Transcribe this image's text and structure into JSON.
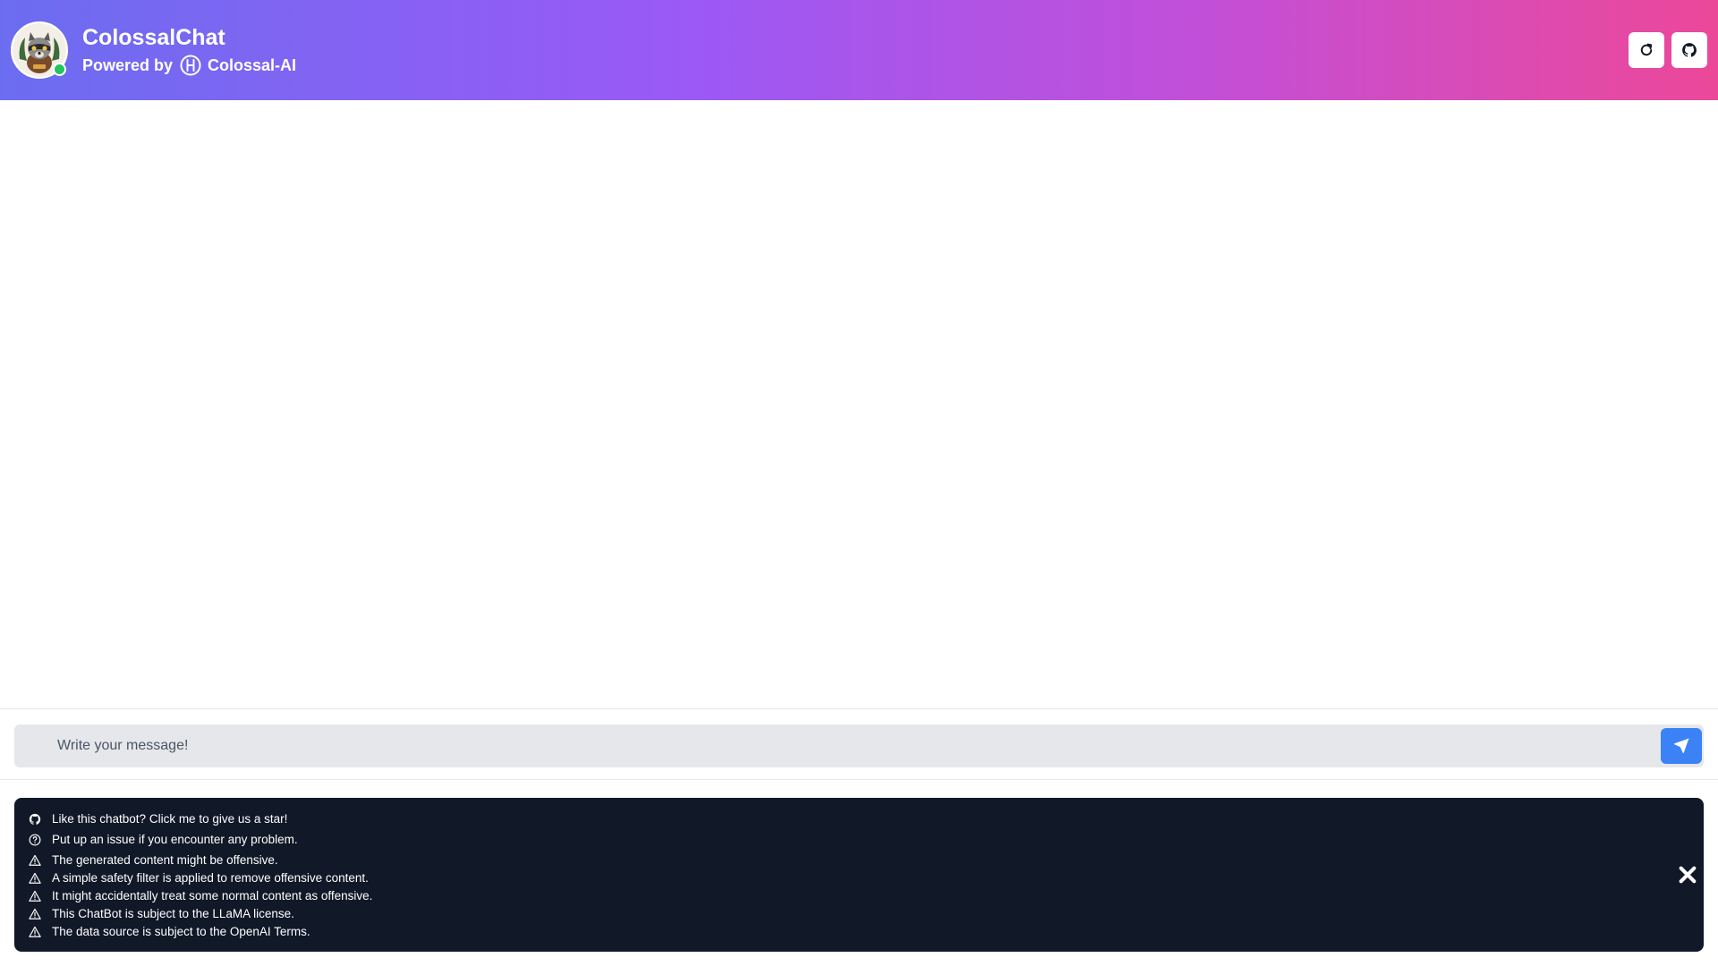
{
  "header": {
    "title": "ColossalChat",
    "powered_by": "Powered by",
    "org_name": "Colossal-AI",
    "refresh_icon": "refresh-icon",
    "github_icon": "github-icon"
  },
  "composer": {
    "placeholder": "Write your message!",
    "value": "",
    "send_icon": "paper-plane-icon"
  },
  "notice": {
    "items": [
      {
        "icon": "github-icon",
        "text": "Like this chatbot? Click me to give us a star!"
      },
      {
        "icon": "question-circle-icon",
        "text": "Put up an issue if you encounter any problem."
      },
      {
        "icon": "warning-triangle-icon",
        "text": "The generated content might be offensive."
      },
      {
        "icon": "warning-triangle-icon",
        "text": "A simple safety filter is applied to remove offensive content."
      },
      {
        "icon": "warning-triangle-icon",
        "text": "It might accidentally treat some normal content as offensive."
      },
      {
        "icon": "warning-triangle-icon",
        "text": "This ChatBot is subject to the LLaMA license."
      },
      {
        "icon": "warning-triangle-icon",
        "text": "The data source is subject to the OpenAI Terms."
      }
    ],
    "close_icon": "close-icon"
  },
  "colors": {
    "header_gradient_start": "#6b6df0",
    "header_gradient_end": "#ec4899",
    "online_status": "#22c55e",
    "send_button": "#3b82f6",
    "notice_bg": "#111827",
    "input_bg": "#e5e7eb"
  }
}
